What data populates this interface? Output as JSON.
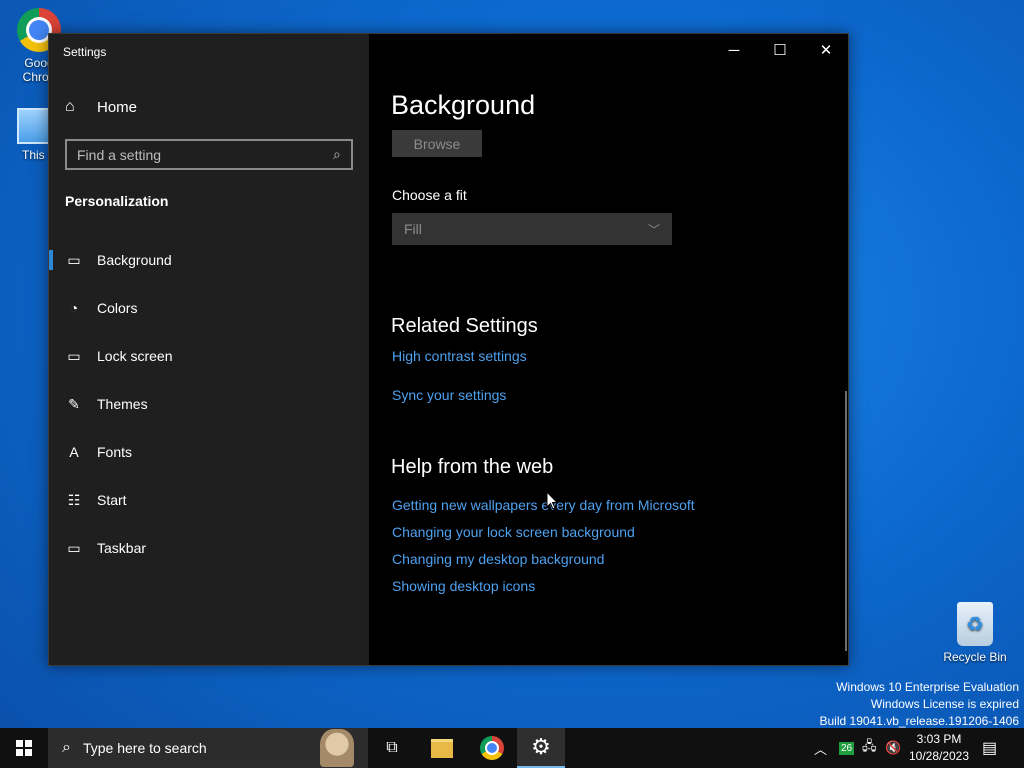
{
  "desktop": {
    "icons": [
      {
        "label": "Goog Chron"
      },
      {
        "label": "This P"
      },
      {
        "label": "Recycle Bin"
      }
    ]
  },
  "window": {
    "title": "Settings",
    "controls": {
      "minimize": "─",
      "maximize": "☐",
      "close": "✕"
    }
  },
  "sidebar": {
    "home_label": "Home",
    "search_placeholder": "Find a setting",
    "section_title": "Personalization",
    "items": [
      {
        "label": "Background",
        "icon": "picture-icon",
        "glyph": "▭",
        "active": true
      },
      {
        "label": "Colors",
        "icon": "palette-icon",
        "glyph": "◔"
      },
      {
        "label": "Lock screen",
        "icon": "lock-screen-icon",
        "glyph": "▭"
      },
      {
        "label": "Themes",
        "icon": "themes-icon",
        "glyph": "✎"
      },
      {
        "label": "Fonts",
        "icon": "fonts-icon",
        "glyph": "A"
      },
      {
        "label": "Start",
        "icon": "start-icon",
        "glyph": "☷"
      },
      {
        "label": "Taskbar",
        "icon": "taskbar-icon",
        "glyph": "▭"
      }
    ]
  },
  "main": {
    "page_title": "Background",
    "browse_label": "Browse",
    "fit_label": "Choose a fit",
    "fit_value": "Fill",
    "related_title": "Related Settings",
    "related_links": [
      "High contrast settings",
      "Sync your settings"
    ],
    "help_title": "Help from the web",
    "help_links": [
      "Getting new wallpapers every day from Microsoft",
      "Changing your lock screen background",
      "Changing my desktop background",
      "Showing desktop icons"
    ]
  },
  "watermark": {
    "line1": "Windows 10 Enterprise Evaluation",
    "line2": "Windows License is expired",
    "line3": "Build 19041.vb_release.191206-1406"
  },
  "taskbar": {
    "search_placeholder": "Type here to search",
    "tray_badge": "26",
    "time": "3:03 PM",
    "date": "10/28/2023"
  },
  "colors": {
    "accent": "#2b88d8",
    "link": "#4ea1ef",
    "sidebar_bg": "#1f1f1f",
    "content_bg": "#000000"
  }
}
